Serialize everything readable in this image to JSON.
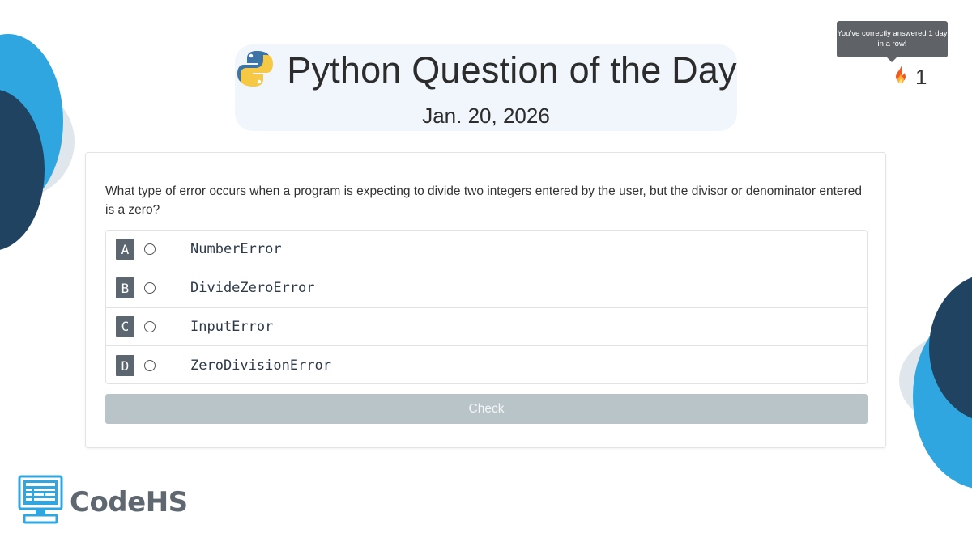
{
  "header": {
    "title": "Python Question of the Day",
    "date": "Jan. 20, 2026",
    "python_logo_icon": "python-logo-icon"
  },
  "streak": {
    "tooltip": "You've correctly answered 1 day in a row!",
    "count": "1",
    "icon": "fire-icon"
  },
  "question": {
    "text": "What type of error occurs when a program is expecting to divide two integers entered by the user, but the divisor or denominator entered is a zero?",
    "options": [
      {
        "letter": "A",
        "text": "NumberError"
      },
      {
        "letter": "B",
        "text": "DivideZeroError"
      },
      {
        "letter": "C",
        "text": "InputError"
      },
      {
        "letter": "D",
        "text": "ZeroDivisionError"
      }
    ],
    "check_label": "Check"
  },
  "brand": {
    "name": "CodeHS",
    "logo_icon": "codehs-monitor-icon"
  },
  "colors": {
    "blob_light_blue": "#2fa6e0",
    "blob_dark_navy": "#1f4360",
    "blob_gray": "#dfe6ec",
    "letter_badge": "#5b6670",
    "check_disabled": "#b8c4c8",
    "title_bg": "#f1f6fc"
  }
}
